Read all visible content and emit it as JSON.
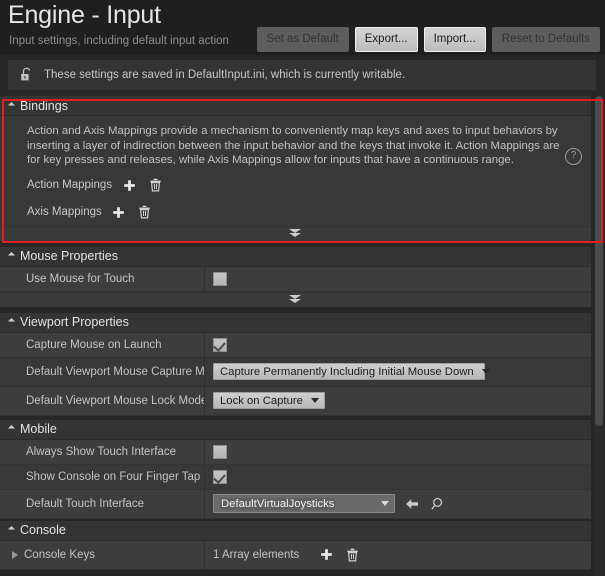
{
  "header": {
    "title": "Engine - Input",
    "subtitle": "Input settings, including default input action",
    "buttons": [
      {
        "label": "Set as Default",
        "state": "disabled"
      },
      {
        "label": "Export...",
        "state": "enabled"
      },
      {
        "label": "Import...",
        "state": "enabled"
      },
      {
        "label": "Reset to Defaults",
        "state": "disabled"
      }
    ]
  },
  "notice": {
    "icon": "unlock-icon",
    "text": "These settings are saved in DefaultInput.ini, which is currently writable."
  },
  "sections": {
    "bindings": {
      "title": "Bindings",
      "description": "Action and Axis Mappings provide a mechanism to conveniently map keys and axes to input behaviors by inserting a layer of indirection between the input behavior and the keys that invoke it. Action Mappings are for key presses and releases, while Axis Mappings allow for inputs that have a continuous range.",
      "help_icon": "help-circle-icon",
      "action_mappings_label": "Action Mappings",
      "axis_mappings_label": "Axis Mappings",
      "add_icon": "plus-icon",
      "delete_icon": "trash-icon"
    },
    "mouse_properties": {
      "title": "Mouse Properties",
      "rows": [
        {
          "label": "Use Mouse for Touch",
          "type": "checkbox",
          "checked": false
        }
      ]
    },
    "viewport_properties": {
      "title": "Viewport Properties",
      "rows": [
        {
          "label": "Capture Mouse on Launch",
          "type": "checkbox",
          "checked": true
        },
        {
          "label": "Default Viewport Mouse Capture M",
          "type": "combo",
          "value": "Capture Permanently Including Initial Mouse Down"
        },
        {
          "label": "Default Viewport Mouse Lock Mode",
          "type": "combo",
          "value": "Lock on Capture"
        }
      ]
    },
    "mobile": {
      "title": "Mobile",
      "rows": [
        {
          "label": "Always Show Touch Interface",
          "type": "checkbox",
          "checked": false
        },
        {
          "label": "Show Console on Four Finger Tap",
          "type": "checkbox",
          "checked": true
        },
        {
          "label": "Default Touch Interface",
          "type": "asset",
          "value": "DefaultVirtualJoysticks"
        }
      ]
    },
    "console": {
      "title": "Console",
      "rows": [
        {
          "label": "Console Keys",
          "type": "array",
          "value": "1 Array elements"
        }
      ]
    }
  },
  "icons": {
    "expander": "double-chevron-down-icon",
    "collapsed_triangle": "triangle-right-icon",
    "expanded_triangle": "triangle-down-icon",
    "use_selected": "arrow-left-icon",
    "browse": "magnifier-icon"
  },
  "colors": {
    "highlight": "#e02020",
    "panel_bg": "#383838",
    "row_bg": "#3d3d3d",
    "header_bg": "#1f1f1f"
  }
}
